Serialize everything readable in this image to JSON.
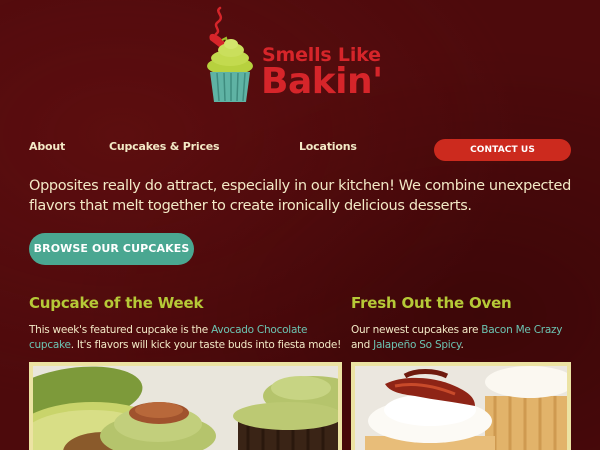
{
  "brand": {
    "line1": "Smells Like",
    "line2": "Bakin'"
  },
  "nav": {
    "items": [
      "About",
      "Cupcakes & Prices",
      "Locations"
    ],
    "contact_label": "CONTACT US"
  },
  "intro": {
    "text": "Opposites really do attract, especially in our kitchen! We combine unexpected flavors that melt together to create ironically delicious desserts.",
    "button_label": "BROWSE OUR CUPCAKES"
  },
  "features": [
    {
      "title": "Cupcake of the Week",
      "text_before": "This week's featured cupcake is the ",
      "link1": "Avocado Chocolate cupcake",
      "text_after": ". It's flavors will kick your taste buds into fiesta mode!"
    },
    {
      "title": "Fresh Out the Oven",
      "text_before": "Our newest cupcakes are ",
      "link1": "Bacon Me Crazy",
      "text_middle": " and ",
      "link2": "Jalapeño So Spicy",
      "text_after": "."
    }
  ],
  "colors": {
    "background": "#4d0a0c",
    "brand_red": "#d6252a",
    "accent_green": "#b6c937",
    "link_teal": "#6cc4b2",
    "button_teal": "#4aa791",
    "contact_red": "#cc2a1e",
    "text_cream": "#f3e9c6",
    "photo_frame": "#ece3a3"
  },
  "icons": {
    "logo": "cupcake-chili-icon"
  }
}
